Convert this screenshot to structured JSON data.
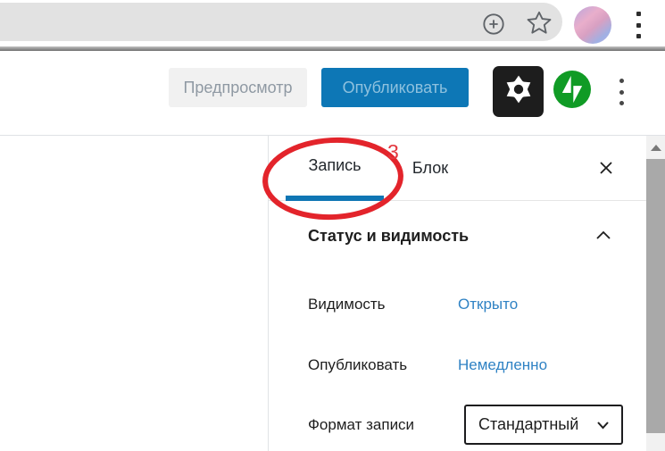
{
  "browser_bar": {
    "url_value": "",
    "zoom_icon": "plus-in-circle",
    "bookmark_icon": "star-outline",
    "avatar": "profile-photo",
    "menu_icon": "vertical-kebab"
  },
  "editor_toolbar": {
    "preview_button": "Предпросмотр",
    "publish_button": "Опубликовать",
    "settings_icon": "gear",
    "jetpack_icon": "jetpack-bolt",
    "more_icon": "vertical-kebab"
  },
  "sidebar": {
    "tabs": [
      {
        "label": "Запись",
        "active": true
      },
      {
        "label": "Блок",
        "active": false
      }
    ],
    "close_icon": "x",
    "panel": {
      "title": "Статус и видимость",
      "collapse_icon": "chevron-up",
      "rows": [
        {
          "label": "Видимость",
          "value": "Открыто",
          "control": "link"
        },
        {
          "label": "Опубликовать",
          "value": "Немедленно",
          "control": "link"
        },
        {
          "label": "Формат записи",
          "value": "Стандартный",
          "control": "select"
        }
      ]
    },
    "scrollbar": {
      "up_arrow": "triangle-up"
    }
  },
  "annotation": {
    "number": "3",
    "shape": "red-ellipse-around-post-tab",
    "color": "#e3242b"
  },
  "colors": {
    "accent_blue": "#0d77b6",
    "active_tab_underline": "#0f76b4",
    "link_blue": "#2f82c4",
    "jetpack_green": "#109b25",
    "annotation_red": "#e3242b",
    "address_bar_gray": "#e2e2e2"
  }
}
